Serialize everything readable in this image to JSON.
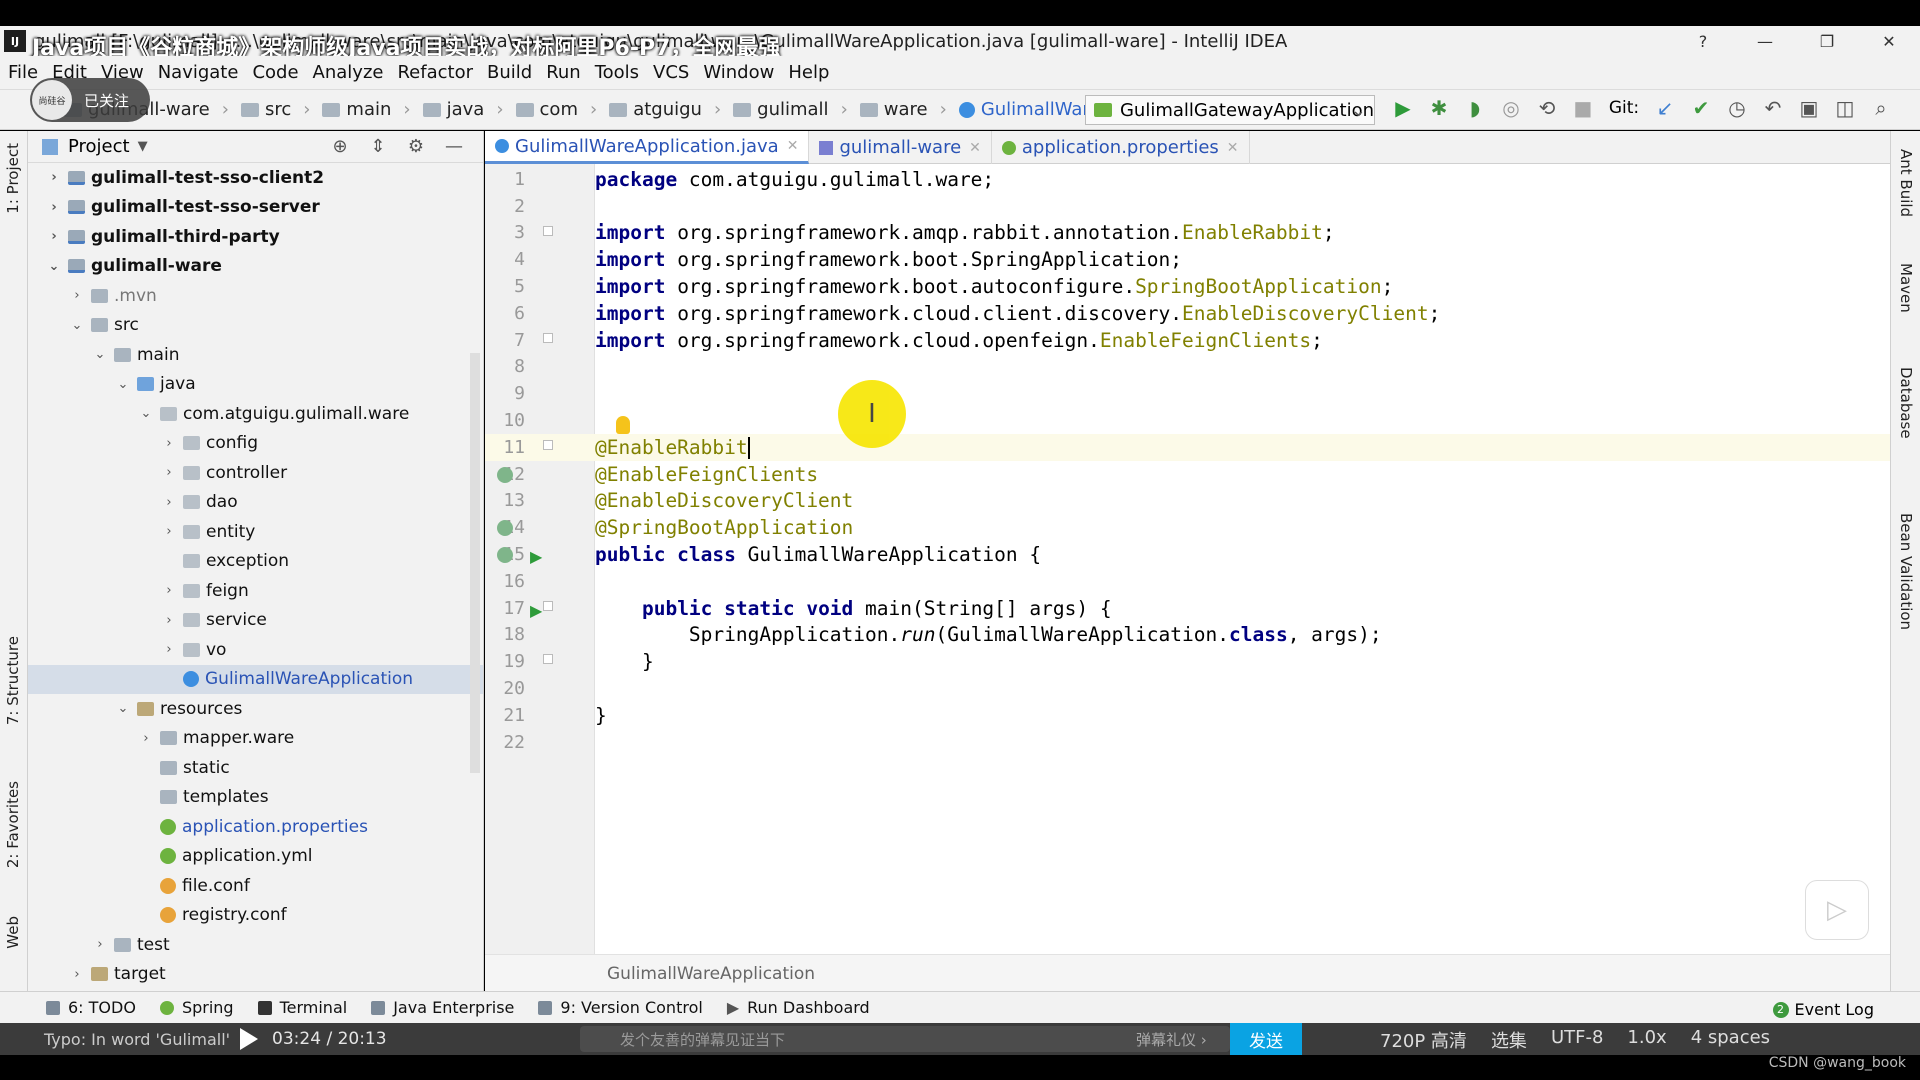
{
  "window": {
    "title": "gulimall [F:\\gulimall] - ...\\gulimall-ware\\src\\main\\java\\com\\atguigu\\gulimall\\ware\\GulimallWareApplication.java [gulimall-ware] - IntelliJ IDEA",
    "logo": "IJ"
  },
  "video_overlay": {
    "title": "Java项目《谷粒商城》架构师级Java项目实战，对标阿里P6-P7，全网最强",
    "follow": "已关注",
    "channel": "尚硅谷"
  },
  "menu": [
    "File",
    "Edit",
    "View",
    "Navigate",
    "Code",
    "Analyze",
    "Refactor",
    "Build",
    "Run",
    "Tools",
    "VCS",
    "Window",
    "Help"
  ],
  "breadcrumbs": [
    "gulimall-ware",
    "src",
    "main",
    "java",
    "com",
    "atguigu",
    "gulimall",
    "ware",
    "GulimallWareApplication"
  ],
  "run_config": "GulimallGatewayApplication",
  "git_label": "Git:",
  "project_panel": {
    "title": "Project",
    "tree": [
      {
        "label": "gulimall-test-sso-client2",
        "depth": 0,
        "arrow": "›",
        "icon": "mod",
        "style": "bold"
      },
      {
        "label": "gulimall-test-sso-server",
        "depth": 0,
        "arrow": "›",
        "icon": "mod",
        "style": "bold"
      },
      {
        "label": "gulimall-third-party",
        "depth": 0,
        "arrow": "›",
        "icon": "mod",
        "style": "bold"
      },
      {
        "label": "gulimall-ware",
        "depth": 0,
        "arrow": "⌄",
        "icon": "mod",
        "style": "bold"
      },
      {
        "label": ".mvn",
        "depth": 1,
        "arrow": "›",
        "icon": "dir",
        "style": "dim"
      },
      {
        "label": "src",
        "depth": 1,
        "arrow": "⌄",
        "icon": "dir",
        "style": ""
      },
      {
        "label": "main",
        "depth": 2,
        "arrow": "⌄",
        "icon": "dir",
        "style": ""
      },
      {
        "label": "java",
        "depth": 3,
        "arrow": "⌄",
        "icon": "src",
        "style": ""
      },
      {
        "label": "com.atguigu.gulimall.ware",
        "depth": 4,
        "arrow": "⌄",
        "icon": "pkg",
        "style": ""
      },
      {
        "label": "config",
        "depth": 5,
        "arrow": "›",
        "icon": "pkg",
        "style": ""
      },
      {
        "label": "controller",
        "depth": 5,
        "arrow": "›",
        "icon": "pkg",
        "style": ""
      },
      {
        "label": "dao",
        "depth": 5,
        "arrow": "›",
        "icon": "pkg",
        "style": ""
      },
      {
        "label": "entity",
        "depth": 5,
        "arrow": "›",
        "icon": "pkg",
        "style": ""
      },
      {
        "label": "exception",
        "depth": 5,
        "arrow": "",
        "icon": "pkg",
        "style": ""
      },
      {
        "label": "feign",
        "depth": 5,
        "arrow": "›",
        "icon": "pkg",
        "style": ""
      },
      {
        "label": "service",
        "depth": 5,
        "arrow": "›",
        "icon": "pkg",
        "style": ""
      },
      {
        "label": "vo",
        "depth": 5,
        "arrow": "›",
        "icon": "pkg",
        "style": ""
      },
      {
        "label": "GulimallWareApplication",
        "depth": 5,
        "arrow": "",
        "icon": "cls",
        "style": "blue sel"
      },
      {
        "label": "resources",
        "depth": 3,
        "arrow": "⌄",
        "icon": "res",
        "style": ""
      },
      {
        "label": "mapper.ware",
        "depth": 4,
        "arrow": "›",
        "icon": "dir",
        "style": ""
      },
      {
        "label": "static",
        "depth": 4,
        "arrow": "",
        "icon": "dir",
        "style": ""
      },
      {
        "label": "templates",
        "depth": 4,
        "arrow": "",
        "icon": "dir",
        "style": ""
      },
      {
        "label": "application.properties",
        "depth": 4,
        "arrow": "",
        "icon": "spring",
        "style": "blue"
      },
      {
        "label": "application.yml",
        "depth": 4,
        "arrow": "",
        "icon": "spring",
        "style": ""
      },
      {
        "label": "file.conf",
        "depth": 4,
        "arrow": "",
        "icon": "conf",
        "style": ""
      },
      {
        "label": "registry.conf",
        "depth": 4,
        "arrow": "",
        "icon": "conf",
        "style": ""
      },
      {
        "label": "test",
        "depth": 2,
        "arrow": "›",
        "icon": "dir",
        "style": ""
      },
      {
        "label": "target",
        "depth": 1,
        "arrow": "›",
        "icon": "res",
        "style": ""
      }
    ]
  },
  "left_tool_tabs": [
    "1: Project",
    "7: Structure",
    "2: Favorites",
    "Web"
  ],
  "right_tool_tabs": [
    "Ant Build",
    "Maven",
    "Database",
    "Bean Validation"
  ],
  "editor_tabs": [
    {
      "label": "GulimallWareApplication.java",
      "icon": "c",
      "active": true
    },
    {
      "label": "gulimall-ware",
      "icon": "m",
      "active": false
    },
    {
      "label": "application.properties",
      "icon": "p",
      "active": false
    }
  ],
  "code": [
    [
      {
        "t": "package",
        "c": "k"
      },
      {
        "t": " com.atguigu.gulimall.ware;",
        "c": ""
      }
    ],
    [],
    [
      {
        "t": "import",
        "c": "k"
      },
      {
        "t": " org.springframework.amqp.rabbit.annotation.",
        "c": ""
      },
      {
        "t": "EnableRabbit",
        "c": "ann"
      },
      {
        "t": ";",
        "c": ""
      }
    ],
    [
      {
        "t": "import",
        "c": "k"
      },
      {
        "t": " org.springframework.boot.SpringApplication;",
        "c": ""
      }
    ],
    [
      {
        "t": "import",
        "c": "k"
      },
      {
        "t": " org.springframework.boot.autoconfigure.",
        "c": ""
      },
      {
        "t": "SpringBootApplication",
        "c": "ann"
      },
      {
        "t": ";",
        "c": ""
      }
    ],
    [
      {
        "t": "import",
        "c": "k"
      },
      {
        "t": " org.springframework.cloud.client.discovery.",
        "c": ""
      },
      {
        "t": "EnableDiscoveryClient",
        "c": "ann"
      },
      {
        "t": ";",
        "c": ""
      }
    ],
    [
      {
        "t": "import",
        "c": "k"
      },
      {
        "t": " org.springframework.cloud.openfeign.",
        "c": ""
      },
      {
        "t": "EnableFeignClients",
        "c": "ann"
      },
      {
        "t": ";",
        "c": ""
      }
    ],
    [],
    [],
    [],
    [
      {
        "t": "@EnableRabbit",
        "c": "ann"
      }
    ],
    [
      {
        "t": "@EnableFeignClients",
        "c": "ann"
      }
    ],
    [
      {
        "t": "@EnableDiscoveryClient",
        "c": "ann"
      }
    ],
    [
      {
        "t": "@SpringBootApplication",
        "c": "ann"
      }
    ],
    [
      {
        "t": "public class",
        "c": "k"
      },
      {
        "t": " GulimallWareApplication {",
        "c": ""
      }
    ],
    [],
    [
      {
        "t": "    ",
        "c": ""
      },
      {
        "t": "public static void",
        "c": "k"
      },
      {
        "t": " main(String[] args) {",
        "c": ""
      }
    ],
    [
      {
        "t": "        SpringApplication.",
        "c": ""
      },
      {
        "t": "run",
        "c": "i"
      },
      {
        "t": "(GulimallWareApplication.",
        "c": ""
      },
      {
        "t": "class",
        "c": "k"
      },
      {
        "t": ", args);",
        "c": ""
      }
    ],
    [
      {
        "t": "    }",
        "c": ""
      }
    ],
    [],
    [
      {
        "t": "}",
        "c": ""
      }
    ],
    []
  ],
  "current_line": 11,
  "editor_breadcrumb": "GulimallWareApplication",
  "bottom_tools": [
    "6: TODO",
    "Spring",
    "Terminal",
    "Java Enterprise",
    "9: Version Control",
    "Run Dashboard"
  ],
  "event_log": {
    "label": "Event Log",
    "count": "2"
  },
  "player": {
    "time": "03:24 / 20:13",
    "status_fragment": "Typo: In word 'Gulimall'",
    "danmu_placeholder": "发个友善的弹幕见证当下",
    "etiquette": "弹幕礼仪 ›",
    "send": "发送",
    "quality": "720P 高清",
    "select": "选集",
    "speed": "1.0x",
    "encoding": "UTF-8",
    "spaces": "4 spaces"
  },
  "footer_credit": "CSDN @wang_book"
}
